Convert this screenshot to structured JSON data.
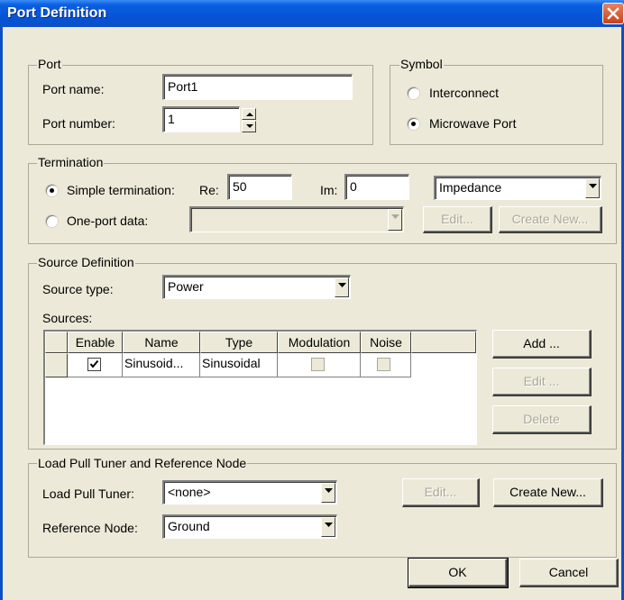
{
  "window": {
    "title": "Port Definition"
  },
  "port": {
    "legend": "Port",
    "name_label": "Port name:",
    "name_value": "Port1",
    "number_label": "Port number:",
    "number_value": "1"
  },
  "symbol": {
    "legend": "Symbol",
    "options": [
      "Interconnect",
      "Microwave Port"
    ],
    "selected": "Microwave Port"
  },
  "termination": {
    "legend": "Termination",
    "simple_label": "Simple termination:",
    "re_label": "Re:",
    "re_value": "50",
    "im_label": "Im:",
    "im_value": "0",
    "mode_value": "Impedance",
    "oneport_label": "One-port data:",
    "oneport_value": "",
    "edit_button": "Edit...",
    "create_new_button": "Create New...",
    "selected": "Simple termination"
  },
  "source": {
    "legend": "Source Definition",
    "type_label": "Source type:",
    "type_value": "Power",
    "sources_label": "Sources:",
    "columns": [
      "",
      "Enable",
      "Name",
      "Type",
      "Modulation",
      "Noise",
      ""
    ],
    "rows": [
      {
        "enable": true,
        "name": "Sinusoid...",
        "type": "Sinusoidal",
        "modulation": false,
        "noise": false
      }
    ],
    "add_button": "Add ...",
    "edit_button": "Edit ...",
    "delete_button": "Delete"
  },
  "loadpull": {
    "legend": "Load Pull Tuner and Reference Node",
    "tuner_label": "Load Pull Tuner:",
    "tuner_value": "<none>",
    "node_label": "Reference Node:",
    "node_value": "Ground",
    "edit_button": "Edit...",
    "create_new_button": "Create New..."
  },
  "footer": {
    "ok_button": "OK",
    "cancel_button": "Cancel"
  }
}
